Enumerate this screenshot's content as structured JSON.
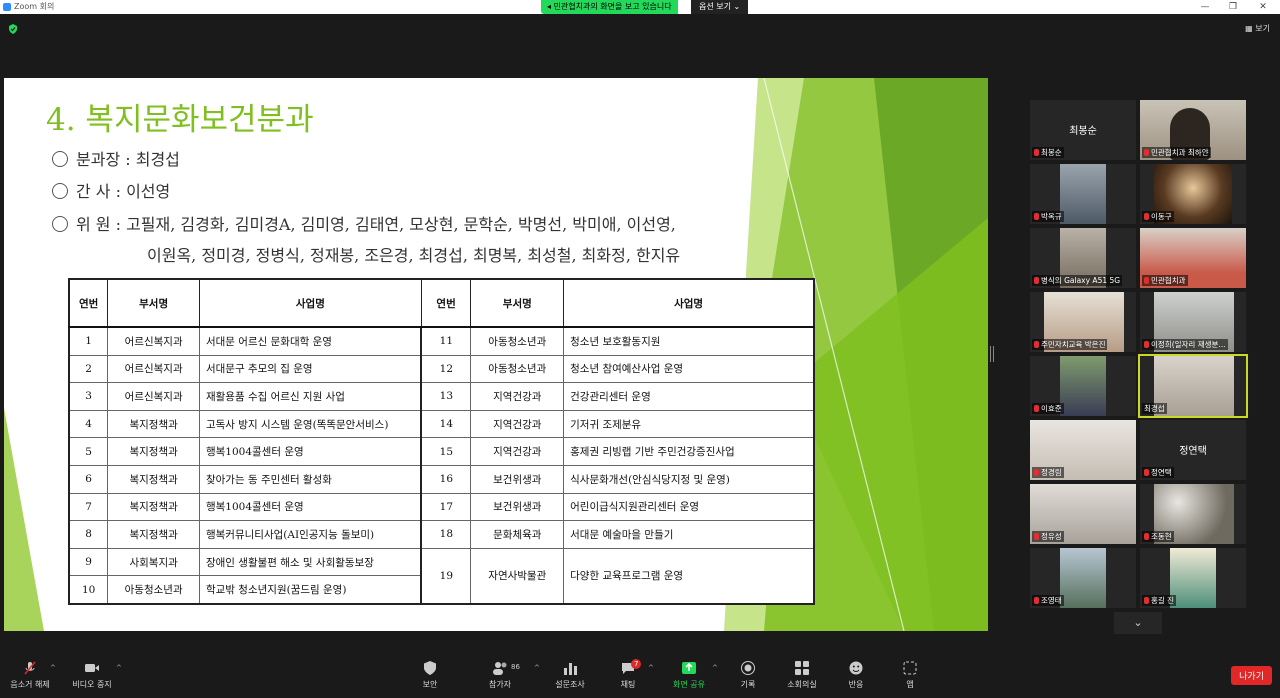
{
  "window": {
    "title": "Zoom 회의"
  },
  "banner": {
    "text": "민관협치과의 화면을 보고 있습니다",
    "view_options": "옵션 보기 ⌄"
  },
  "top_right": {
    "view_label": "보기"
  },
  "slide": {
    "title": "4. 복지문화보건분과",
    "chair": "분과장 : 최경섭",
    "secretary": "간    사 : 이선영",
    "members_line1": "위    원 : 고필재, 김경화, 김미경A, 김미영, 김태연, 모상현, 문학순, 박명선, 박미애, 이선영,",
    "members_line2": "이원옥, 정미경, 정병식, 정재봉, 조은경, 최경섭, 최명복, 최성철, 최화정, 한지유",
    "table": {
      "headers": [
        "연번",
        "부서명",
        "사업명",
        "연번",
        "부서명",
        "사업명"
      ],
      "rows": [
        {
          "no": "1",
          "dept": "어르신복지과",
          "project": "서대문 어르신 문화대학 운영",
          "no2": "11",
          "dept2": "아동청소년과",
          "project2": "청소년 보호활동지원"
        },
        {
          "no": "2",
          "dept": "어르신복지과",
          "project": "서대문구 추모의 집 운영",
          "no2": "12",
          "dept2": "아동청소년과",
          "project2": "청소년 참여예산사업 운영"
        },
        {
          "no": "3",
          "dept": "어르신복지과",
          "project": "재활용품 수집 어르신 지원 사업",
          "no2": "13",
          "dept2": "지역건강과",
          "project2": "건강관리센터 운영"
        },
        {
          "no": "4",
          "dept": "복지정책과",
          "project": "고독사 방지 시스템 운영(똑똑문안서비스)",
          "no2": "14",
          "dept2": "지역건강과",
          "project2": "기저귀 조제분유"
        },
        {
          "no": "5",
          "dept": "복지정책과",
          "project": "행복1004콜센터 운영",
          "no2": "15",
          "dept2": "지역건강과",
          "project2": "홍제권 리빙랩 기반 주민건강증진사업"
        },
        {
          "no": "6",
          "dept": "복지정책과",
          "project": "찾아가는 동 주민센터 활성화",
          "no2": "16",
          "dept2": "보건위생과",
          "project2": "식사문화개선(안심식당지정 및 운영)"
        },
        {
          "no": "7",
          "dept": "복지정책과",
          "project": "행복1004콜센터 운영",
          "no2": "17",
          "dept2": "보건위생과",
          "project2": "어린이급식지원관리센터 운영"
        },
        {
          "no": "8",
          "dept": "복지정책과",
          "project": "행복커뮤니티사업(AI인공지능 돌보미)",
          "no2": "18",
          "dept2": "문화체육과",
          "project2": "서대문 예술마을 만들기"
        },
        {
          "no": "9",
          "dept": "사회복지과",
          "project": "장애인 생활불편 해소 및 사회활동보장",
          "no2": "19",
          "dept2": "자연사박물관",
          "project2": "다양한 교육프로그램 운영"
        },
        {
          "no": "10",
          "dept": "아동청소년과",
          "project": "학교밖 청소년지원(꿈드림 운영)"
        }
      ]
    }
  },
  "participants": [
    {
      "name": "최봉순",
      "big_name": "최봉순",
      "video": false
    },
    {
      "name": "민관협치과 최하얀",
      "video": true
    },
    {
      "name": "박옥규",
      "video": true
    },
    {
      "name": "이동구",
      "video": true
    },
    {
      "name": "병식의 Galaxy A51 5G",
      "video": true
    },
    {
      "name": "민관협치과",
      "video": true
    },
    {
      "name": "주민자치교육 박은진",
      "video": true
    },
    {
      "name": "이정희(일자리 재생분...",
      "video": true
    },
    {
      "name": "이효준",
      "video": true
    },
    {
      "name": "최경섭",
      "video": true
    },
    {
      "name": "정경림",
      "video": true
    },
    {
      "name": "정연택",
      "big_name": "정연택",
      "video": false
    },
    {
      "name": "정유성",
      "video": true
    },
    {
      "name": "조동현",
      "video": true
    },
    {
      "name": "조영태",
      "video": true
    },
    {
      "name": "홍길 진",
      "video": true
    }
  ],
  "toolbar": {
    "mute": "음소거 해제",
    "video": "비디오 중지",
    "security": "보안",
    "participants": "참가자",
    "participant_count": "86",
    "polls": "설문조사",
    "chat": "채팅",
    "chat_badge": "7",
    "share": "화면 공유",
    "record": "기록",
    "breakout": "소회의실",
    "reactions": "반응",
    "apps": "앱",
    "leave": "나가기"
  },
  "colors": {
    "title_green": "#7fbf1e",
    "share_banner": "#23d959",
    "leave_red": "#e02828",
    "active_speaker": "#c9d926"
  }
}
